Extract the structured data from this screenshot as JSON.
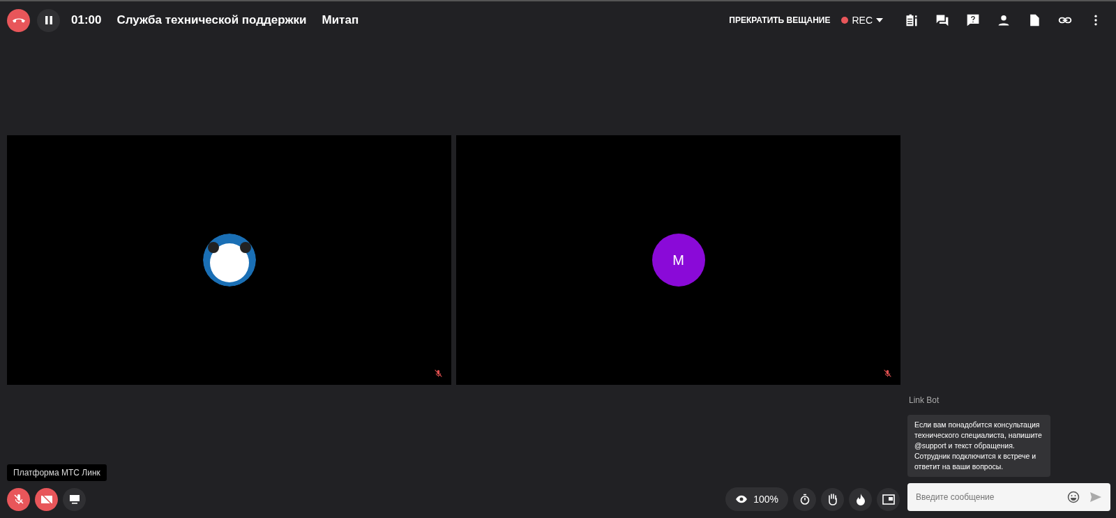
{
  "header": {
    "timer": "01:00",
    "title": "Служба технической поддержки",
    "meeting_type": "Митап",
    "paused": false,
    "stop_stream": "ПРЕКРАТИТЬ ВЕЩАНИЕ",
    "rec": {
      "label": "REC",
      "recording": true
    }
  },
  "tiles": [
    {
      "kind": "image",
      "muted": true
    },
    {
      "kind": "initial",
      "initial": "M",
      "color": "#8a0ad8",
      "muted": true
    }
  ],
  "tooltip": "Платформа МТС Линк",
  "controls": {
    "mic_on": false,
    "camera_on": false,
    "viewers": "100%"
  },
  "chat": {
    "sender": "Link Bot",
    "message": "Если вам понадобится консультация технического специалиста, напишите @support и текст обращения. Сотрудник подключится к встрече и ответит на ваши вопросы.",
    "placeholder": "Введите сообщение"
  }
}
